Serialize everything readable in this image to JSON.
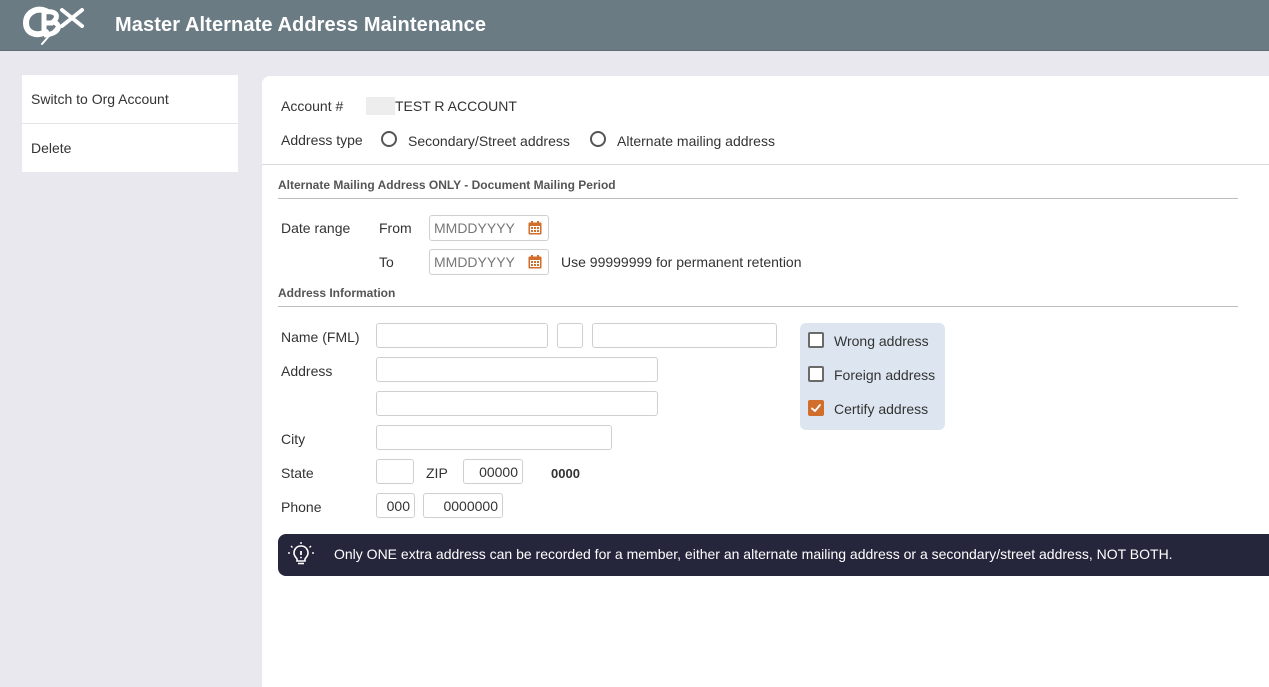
{
  "header": {
    "title": "Master Alternate Address Maintenance",
    "logo_text": "CBX"
  },
  "sidebar": {
    "items": [
      {
        "label": "Switch to Org Account"
      },
      {
        "label": "Delete"
      }
    ]
  },
  "account": {
    "label": "Account #",
    "name": "TEST R ACCOUNT"
  },
  "address_type": {
    "label": "Address type",
    "options": [
      {
        "label": "Secondary/Street address",
        "selected": false
      },
      {
        "label": "Alternate mailing address",
        "selected": false
      }
    ]
  },
  "mailing_period": {
    "section_title": "Alternate Mailing Address ONLY - Document Mailing Period",
    "date_range_label": "Date range",
    "from_label": "From",
    "to_label": "To",
    "date_placeholder": "MMDDYYYY",
    "hint": "Use 99999999 for permanent retention"
  },
  "address_info": {
    "section_title": "Address Information",
    "name_label": "Name (FML)",
    "address_label": "Address",
    "city_label": "City",
    "state_label": "State",
    "zip_label": "ZIP",
    "zip_value": "00000",
    "zip_suffix": "0000",
    "phone_label": "Phone",
    "phone_area": "000",
    "phone_number": "0000000"
  },
  "flags": [
    {
      "label": "Wrong address",
      "checked": false
    },
    {
      "label": "Foreign address",
      "checked": false
    },
    {
      "label": "Certify address",
      "checked": true
    }
  ],
  "notice": {
    "text": "Only ONE extra address can be recorded for a member, either an alternate mailing address or a secondary/street address, NOT BOTH."
  },
  "colors": {
    "header_bg": "#6b7b84",
    "accent": "#d16e2c",
    "banner_bg": "#25253b",
    "checks_bg": "#dde6f0"
  }
}
